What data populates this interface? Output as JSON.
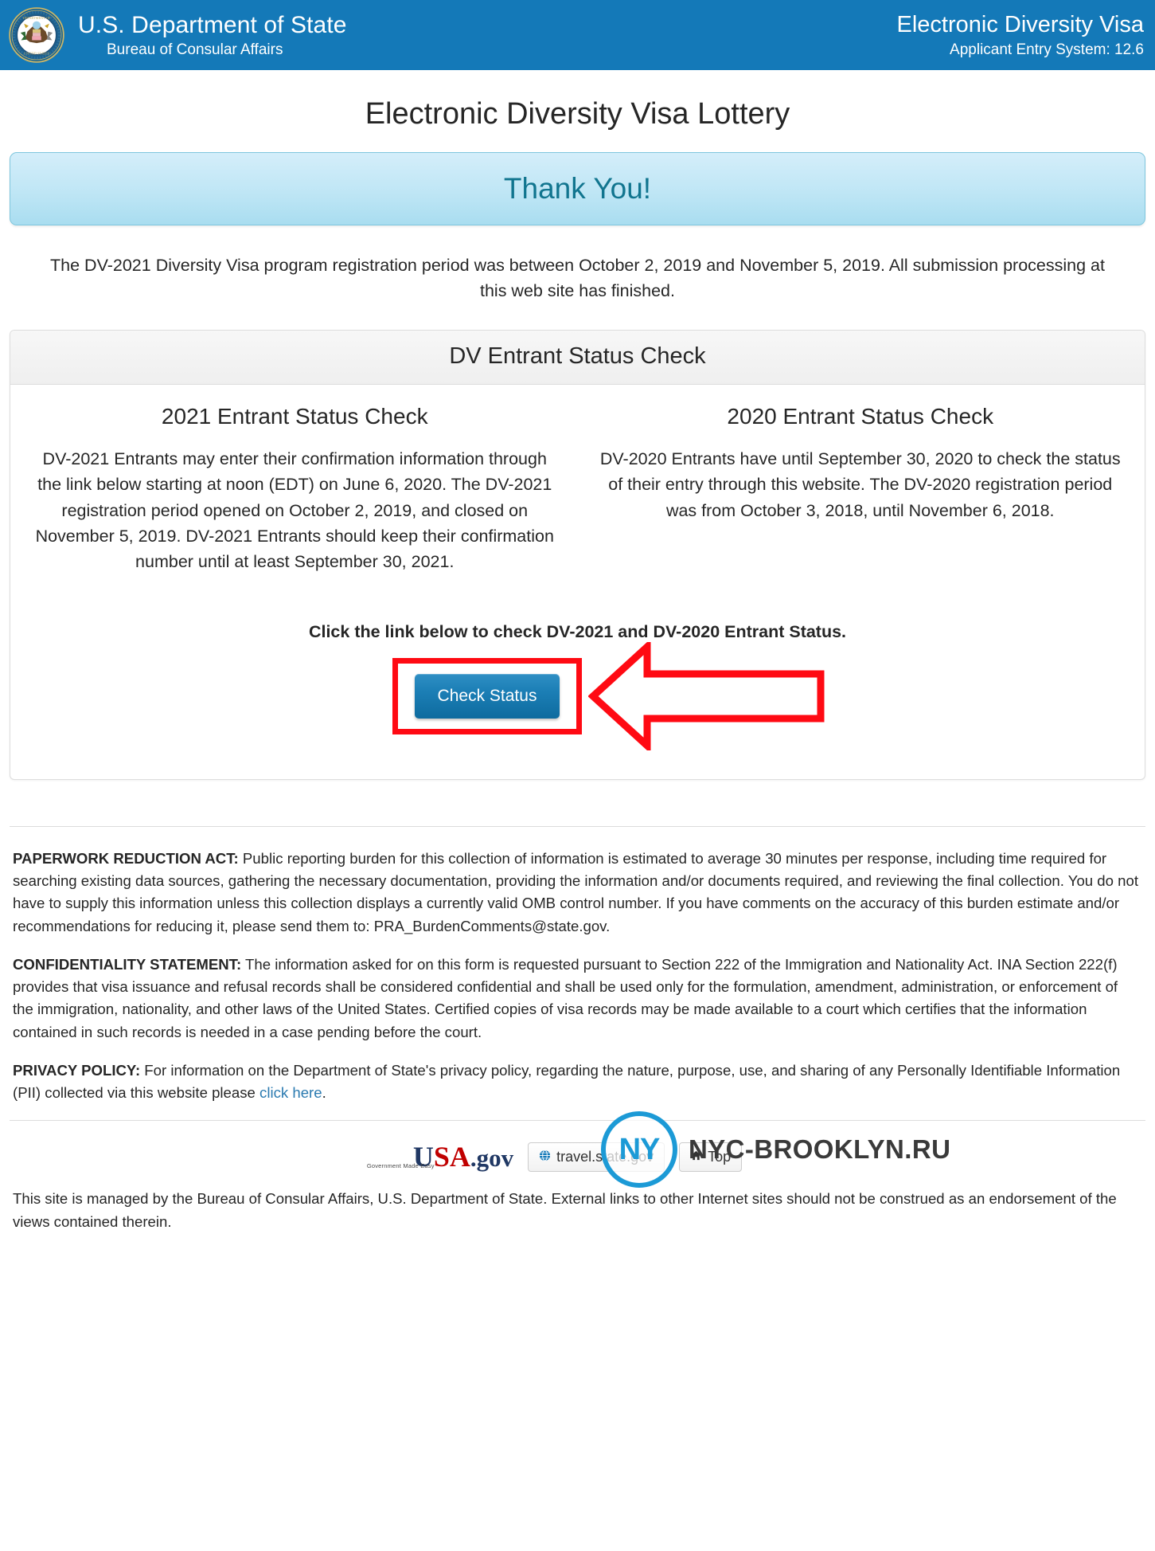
{
  "header": {
    "seal_icon": "us-department-of-state-seal",
    "dept_title": "U.S. Department of State",
    "dept_subtitle": "Bureau of Consular Affairs",
    "system_title": "Electronic Diversity Visa",
    "system_subtitle": "Applicant Entry System: 12.6",
    "background_color": "#1479B8"
  },
  "page": {
    "title": "Electronic Diversity Visa Lottery",
    "banner_text": "Thank You!",
    "banner_color": "#11758F",
    "intro_paragraph": "The DV-2021 Diversity Visa program registration period was between October 2, 2019 and November 5, 2019. All submission processing at this web site has finished."
  },
  "panel": {
    "heading": "DV Entrant Status Check",
    "columns": [
      {
        "title": "2021 Entrant Status Check",
        "text": "DV-2021 Entrants may enter their confirmation information through the link below starting at noon (EDT) on June 6, 2020. The DV-2021 registration period opened on October 2, 2019, and closed on November 5, 2019. DV-2021 Entrants should keep their confirmation number until at least September 30, 2021."
      },
      {
        "title": "2020 Entrant Status Check",
        "text": "DV-2020 Entrants have until September 30, 2020 to check the status of their entry through this website. The DV-2020 registration period was from October 3, 2018, until November 6, 2018."
      }
    ],
    "cta_text": "Click the link below to check DV-2021 and DV-2020 Entrant Status.",
    "check_status_button": "Check Status",
    "annotation_color": "#FF0A13"
  },
  "legal": {
    "paperwork_label": "PAPERWORK REDUCTION ACT:",
    "paperwork_text": " Public reporting burden for this collection of information is estimated to average 30 minutes per response, including time required for searching existing data sources, gathering the necessary documentation, providing the information and/or documents required, and reviewing the final collection. You do not have to supply this information unless this collection displays a currently valid OMB control number. If you have comments on the accuracy of this burden estimate and/or recommendations for reducing it, please send them to: PRA_BurdenComments@state.gov.",
    "confidentiality_label": "CONFIDENTIALITY STATEMENT:",
    "confidentiality_text": " The information asked for on this form is requested pursuant to Section 222 of the Immigration and Nationality Act. INA Section 222(f) provides that visa issuance and refusal records shall be considered confidential and shall be used only for the formulation, amendment, administration, or enforcement of the immigration, nationality, and other laws of the United States. Certified copies of visa records may be made available to a court which certifies that the information contained in such records is needed in a case pending before the court.",
    "privacy_label": "PRIVACY POLICY:",
    "privacy_text": " For information on the Department of State's privacy policy, regarding the nature, purpose, use, and sharing of any Personally Identifiable Information (PII) collected via this website please ",
    "privacy_link": "click here",
    "privacy_text_end": "."
  },
  "footer": {
    "usagov_u": "U",
    "usagov_sa": "SA",
    "usagov_dotgov": ".gov",
    "usagov_tagline": "Government Made Easy",
    "travel_button": "travel.state.gov",
    "travel_icon": "globe-icon",
    "top_button": "Top",
    "top_icon": "home-icon",
    "note": "This site is managed by the Bureau of Consular Affairs, U.S. Department of State. External links to other Internet sites should not be construed as an endorsement of the views contained therein."
  },
  "watermark": {
    "badge_text": "NY",
    "label": "NYC-BROOKLYN.RU",
    "color": "#1C9AD6"
  }
}
